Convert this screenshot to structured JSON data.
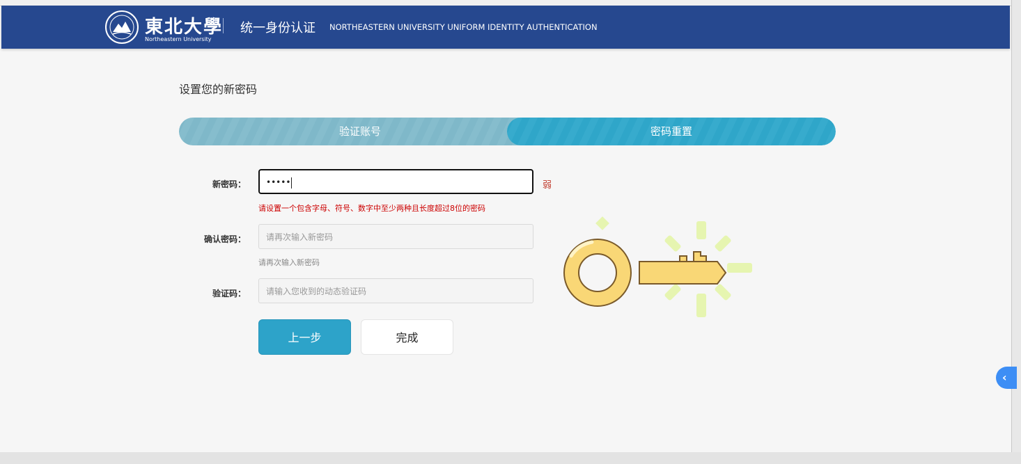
{
  "header": {
    "logo_cn": "東北大學",
    "logo_en": "Northeastern University",
    "system_cn": "统一身份认证",
    "system_en": "NORTHEASTERN UNIVERSITY UNIFORM IDENTITY AUTHENTICATION"
  },
  "page": {
    "title": "设置您的新密码"
  },
  "steps": [
    {
      "label": "验证账号",
      "state": "done"
    },
    {
      "label": "密码重置",
      "state": "active"
    }
  ],
  "form": {
    "new_password": {
      "label": "新密码：",
      "value": "•••••",
      "strength": "弱",
      "error": "请设置一个包含字母、符号、数字中至少两种且长度超过8位的密码"
    },
    "confirm_password": {
      "label": "确认密码：",
      "placeholder": "请再次输入新密码",
      "hint": "请再次输入新密码"
    },
    "verification_code": {
      "label": "验证码：",
      "placeholder": "请输入您收到的动态验证码"
    }
  },
  "buttons": {
    "prev": "上一步",
    "done": "完成"
  },
  "colors": {
    "header": "#26488f",
    "accent": "#2da3c9",
    "error": "#cc0000"
  },
  "icons": [
    "university-seal-icon",
    "key-illustration",
    "chevron-left-icon"
  ]
}
